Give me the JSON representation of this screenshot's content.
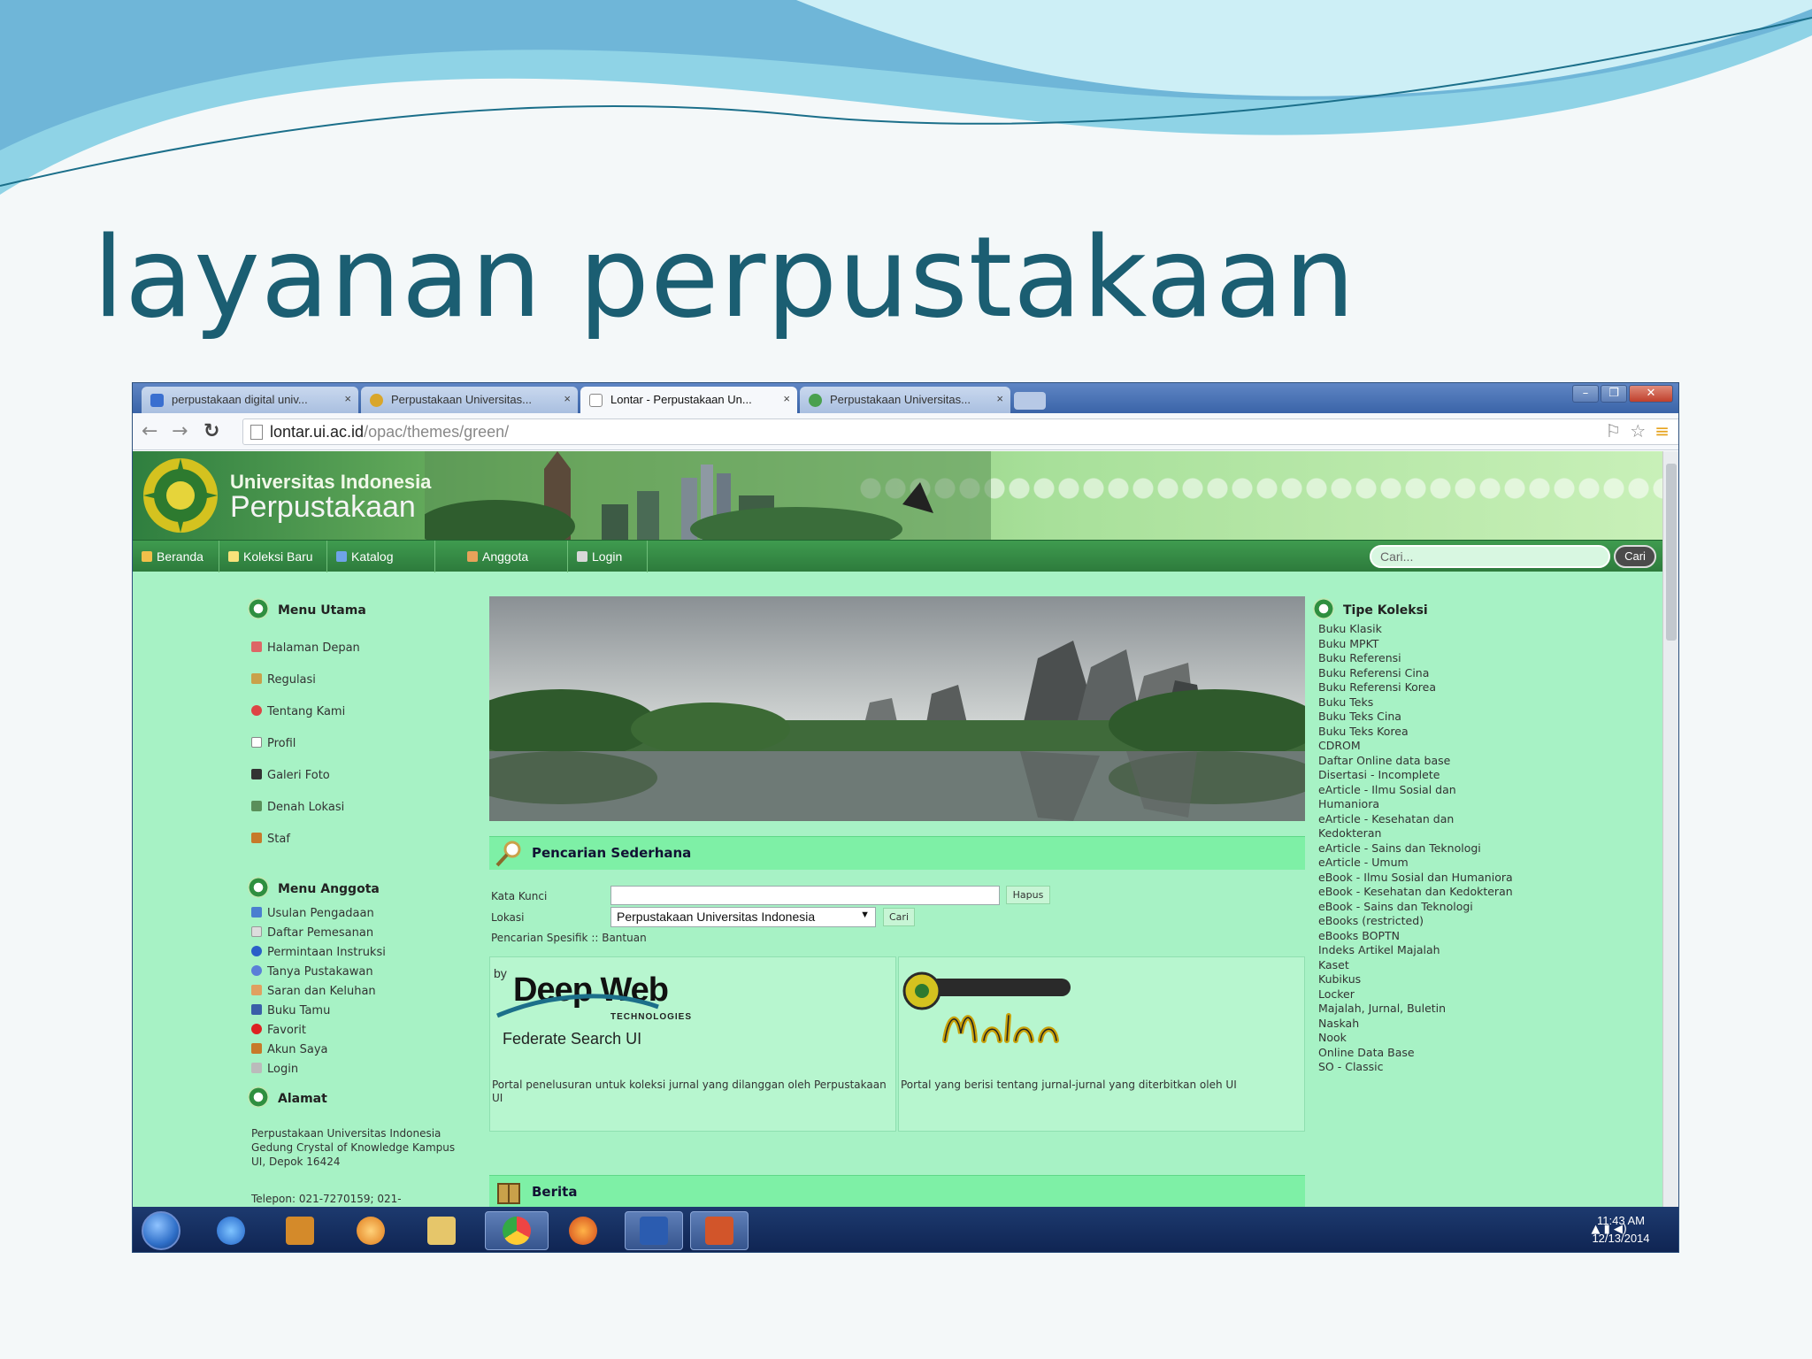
{
  "slide": {
    "title": "layanan perpustakaan"
  },
  "browser": {
    "tabs": [
      {
        "label": "perpustakaan digital univ...",
        "active": false
      },
      {
        "label": "Perpustakaan Universitas...",
        "active": false
      },
      {
        "label": "Lontar - Perpustakaan Un...",
        "active": true
      },
      {
        "label": "Perpustakaan Universitas...",
        "active": false
      }
    ],
    "url_host": "lontar.ui.ac.id",
    "url_path": "/opac/themes/green/"
  },
  "site": {
    "brand_line1": "Universitas Indonesia",
    "brand_line2": "Perpustakaan",
    "nav": [
      "Beranda",
      "Koleksi Baru",
      "Katalog",
      "Anggota",
      "Login"
    ],
    "search_placeholder": "Cari...",
    "search_button": "Cari"
  },
  "left": {
    "menu_utama_title": "Menu Utama",
    "menu_utama": [
      "Halaman Depan",
      "Regulasi",
      "Tentang Kami",
      "Profil",
      "Galeri Foto",
      "Denah Lokasi",
      "Staf"
    ],
    "menu_anggota_title": "Menu Anggota",
    "menu_anggota": [
      "Usulan Pengadaan",
      "Daftar Pemesanan",
      "Permintaan Instruksi",
      "Tanya Pustakawan",
      "Saran dan Keluhan",
      "Buku Tamu",
      "Favorit",
      "Akun Saya",
      "Login"
    ],
    "alamat_title": "Alamat",
    "alamat": "Perpustakaan Universitas Indonesia Gedung Crystal of Knowledge Kampus UI, Depok 16424",
    "telepon": "Telepon: 021-7270159; 021-"
  },
  "center": {
    "search_title": "Pencarian Sederhana",
    "kata_kunci_label": "Kata Kunci",
    "hapus_button": "Hapus",
    "lokasi_label": "Lokasi",
    "lokasi_value": "Perpustakaan Universitas Indonesia",
    "cari_button": "Cari",
    "links_line": "Pencarian Spesifik :: Bantuan",
    "deepweb_by": "by",
    "deepweb_name": "Deep Web",
    "deepweb_tech": "TECHNOLOGIES",
    "deepweb_federate": "Federate Search UI",
    "deepweb_desc": "Portal penelusuran untuk koleksi jurnal yang dilanggan oleh Perpustakaan UI",
    "makara_desc": "Portal yang berisi tentang jurnal-jurnal yang diterbitkan oleh UI",
    "berita_title": "Berita"
  },
  "right": {
    "title": "Tipe Koleksi",
    "items": [
      "Buku Klasik",
      "Buku MPKT",
      "Buku Referensi",
      "Buku Referensi Cina",
      "Buku Referensi Korea",
      "Buku Teks",
      "Buku Teks Cina",
      "Buku Teks Korea",
      "CDROM",
      "Daftar Online data base",
      "Disertasi - Incomplete",
      "eArticle - Ilmu Sosial dan Humaniora",
      "eArticle - Kesehatan dan Kedokteran",
      "eArticle - Sains dan Teknologi",
      "eArticle - Umum",
      "eBook - Ilmu Sosial dan Humaniora",
      "eBook - Kesehatan dan Kedokteran",
      "eBook - Sains dan Teknologi",
      "eBooks (restricted)",
      "eBooks BOPTN",
      "Indeks Artikel Majalah",
      "Kaset",
      "Kubikus",
      "Locker",
      "Majalah, Jurnal, Buletin",
      "Naskah",
      "Nook",
      "Online Data Base",
      "SO - Classic"
    ]
  },
  "taskbar": {
    "time": "11:43 AM",
    "date": "12/13/2014"
  }
}
